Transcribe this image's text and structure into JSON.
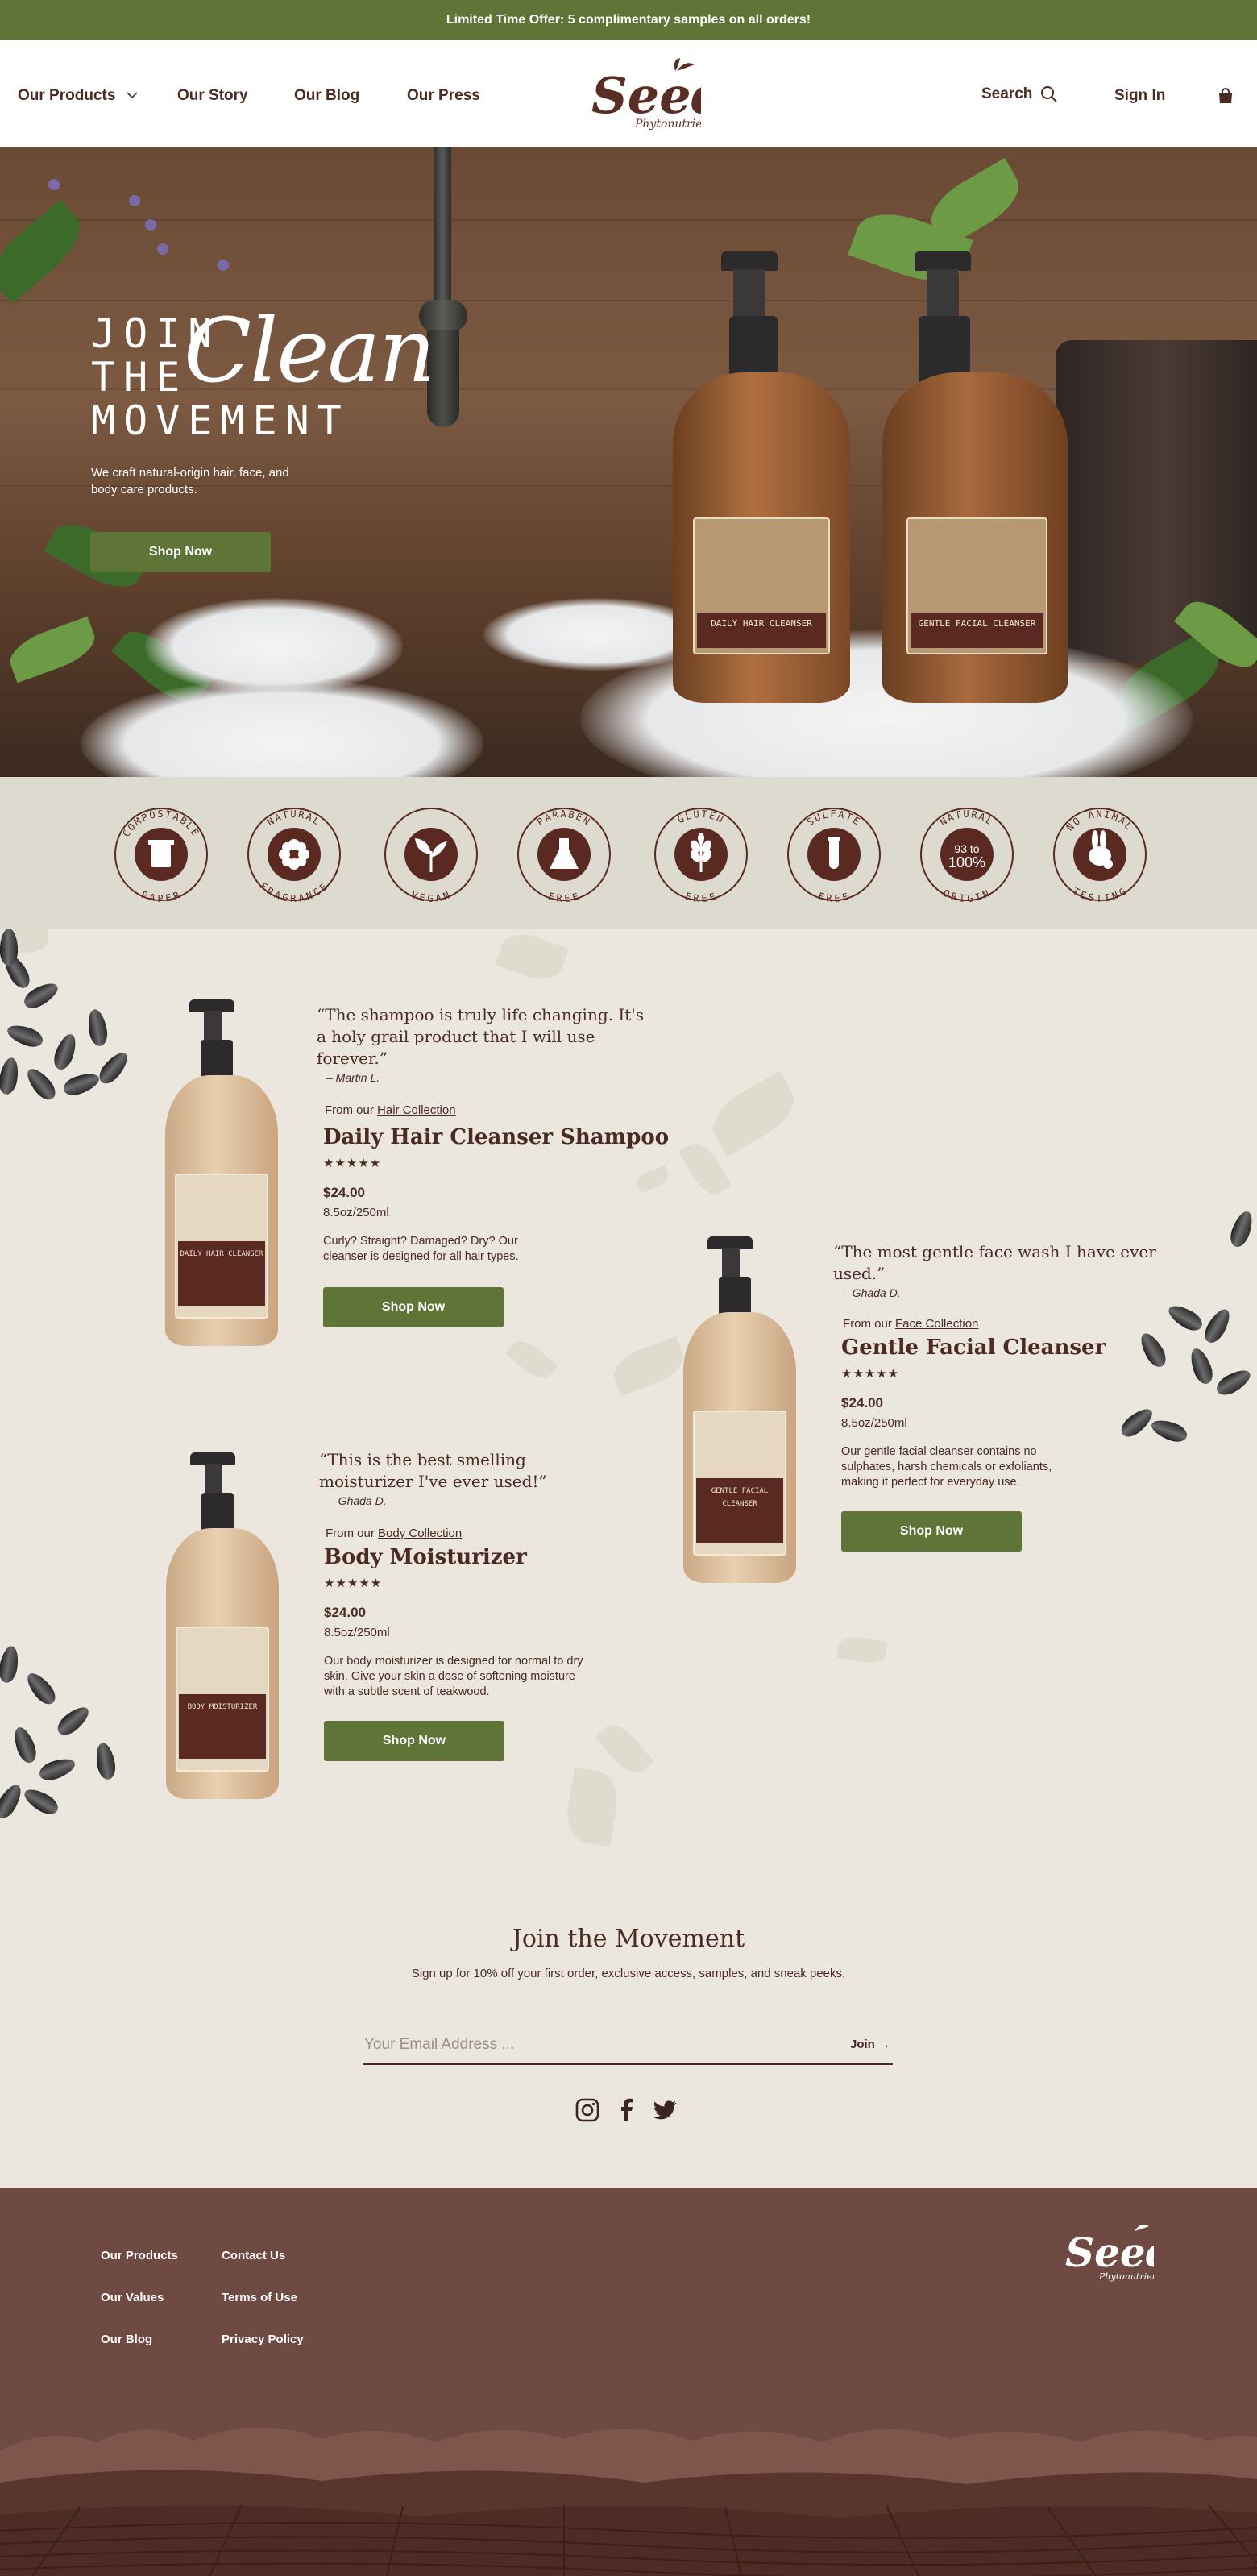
{
  "announcement": "Limited Time Offer: 5 complimentary samples on all orders!",
  "nav": {
    "products": "Our Products",
    "story": "Our Story",
    "blog": "Our Blog",
    "press": "Our Press",
    "search": "Search",
    "signin": "Sign In"
  },
  "brand": {
    "logo_text": "Seed",
    "logo_sub": "Phytonutrients"
  },
  "hero": {
    "line1": "JOIN",
    "line2": "THE",
    "clean": "Clean",
    "line3": "MOVEMENT",
    "subtitle": "We craft natural-origin hair, face, and body care products.",
    "cta": "Shop Now"
  },
  "badges": [
    {
      "label_top": "COMPOSTABLE",
      "label_bottom": "PAPER",
      "icon": "cup-icon"
    },
    {
      "label_top": "NATURAL",
      "label_bottom": "FRAGRANCE",
      "icon": "flower-icon"
    },
    {
      "label_top": "",
      "label_bottom": "VEGAN",
      "icon": "sprout-icon"
    },
    {
      "label_top": "PARABEN",
      "label_bottom": "FREE",
      "icon": "flask-icon"
    },
    {
      "label_top": "GLUTEN",
      "label_bottom": "FREE",
      "icon": "wheat-icon"
    },
    {
      "label_top": "SULFATE",
      "label_bottom": "FREE",
      "icon": "test-tube-icon"
    },
    {
      "label_top": "NATURAL",
      "label_bottom": "ORIGIN",
      "icon": "percent-icon",
      "center_text": "93 to 100%"
    },
    {
      "label_top": "NO ANIMAL",
      "label_bottom": "TESTING",
      "icon": "rabbit-icon"
    }
  ],
  "products": [
    {
      "quote": "“The shampoo is truly life changing. It's a holy grail product that I will use forever.”",
      "author": "– Martin L.",
      "from_prefix": "From our",
      "collection": "Hair Collection",
      "name": "Daily Hair Cleanser Shampoo",
      "stars": "★★★★★",
      "price": "$24.00",
      "size": "8.5oz/250ml",
      "description": "Curly? Straight? Damaged? Dry? Our cleanser is designed for all hair types.",
      "cta": "Shop Now",
      "label": "DAILY HAIR CLEANSER"
    },
    {
      "quote": "“The most gentle face wash I have ever used.”",
      "author": "– Ghada D.",
      "from_prefix": "From our",
      "collection": "Face Collection",
      "name": "Gentle Facial Cleanser",
      "stars": "★★★★★",
      "price": "$24.00",
      "size": "8.5oz/250ml",
      "description": "Our gentle facial cleanser contains no sulphates, harsh chemicals or exfoliants, making it perfect for everyday use.",
      "cta": "Shop Now",
      "label": "GENTLE FACIAL CLEANSER"
    },
    {
      "quote": "“This is the best smelling moisturizer I've ever used!”",
      "author": "– Ghada D.",
      "from_prefix": "From our",
      "collection": "Body Collection",
      "name": "Body Moisturizer",
      "stars": "★★★★★",
      "price": "$24.00",
      "size": "8.5oz/250ml",
      "description": "Our body moisturizer is designed for normal to dry skin. Give your skin a dose of softening moisture with a subtle scent of teakwood.",
      "cta": "Shop Now",
      "label": "BODY MOISTURIZER"
    }
  ],
  "hero_bottles": [
    {
      "label": "DAILY HAIR CLEANSER"
    },
    {
      "label": "GENTLE FACIAL CLEANSER"
    }
  ],
  "newsletter": {
    "title": "Join the Movement",
    "subtitle": "Sign up for 10% off your first order, exclusive access, samples, and sneak peeks.",
    "placeholder": "Your Email Address ...",
    "join": "Join →"
  },
  "footer": {
    "col1": [
      "Our Products",
      "Our Values",
      "Our Blog"
    ],
    "col2": [
      "Contact Us",
      "Terms of Use",
      "Privacy Policy"
    ]
  },
  "colors": {
    "brand_green": "#5f7538",
    "brand_brown": "#4a2a22",
    "footer_brown": "#6e4a42",
    "cream": "#ebe7de"
  }
}
